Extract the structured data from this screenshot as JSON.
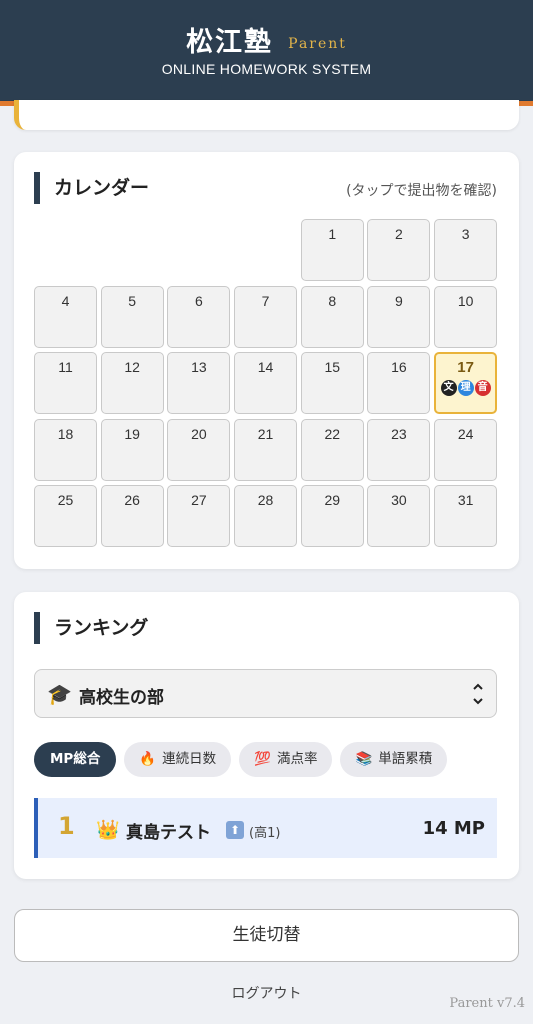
{
  "header": {
    "title": "松江塾",
    "badge": "Parent",
    "subtitle": "ONLINE HOMEWORK SYSTEM"
  },
  "calendar": {
    "title": "カレンダー",
    "hint": "(タップで提出物を確認)",
    "leading_blanks": 4,
    "days": [
      "1",
      "2",
      "3",
      "4",
      "5",
      "6",
      "7",
      "8",
      "9",
      "10",
      "11",
      "12",
      "13",
      "14",
      "15",
      "16",
      "17",
      "18",
      "19",
      "20",
      "21",
      "22",
      "23",
      "24",
      "25",
      "26",
      "27",
      "28",
      "29",
      "30",
      "31"
    ],
    "today": "17",
    "today_subjects": [
      {
        "label": "文",
        "color": "#222222"
      },
      {
        "label": "理",
        "color": "#2e86de"
      },
      {
        "label": "音",
        "color": "#d63031"
      }
    ]
  },
  "ranking": {
    "title": "ランキング",
    "select": {
      "icon": "🎓",
      "value": "高校生の部",
      "chevron": "⌃⌄"
    },
    "tabs": [
      {
        "icon": "",
        "label": "MP総合",
        "active": true
      },
      {
        "icon": "🔥",
        "label": "連続日数",
        "active": false
      },
      {
        "icon": "💯",
        "label": "満点率",
        "active": false
      },
      {
        "icon": "📚",
        "label": "単語累積",
        "active": false
      }
    ],
    "entries": [
      {
        "rank": "1",
        "crown": "👑",
        "name": "真島テスト",
        "up": "⬆",
        "grade": "(高1)",
        "points": "14 MP"
      }
    ]
  },
  "footer": {
    "switch_label": "生徒切替",
    "logout_label": "ログアウト",
    "version": "Parent v7.4"
  }
}
